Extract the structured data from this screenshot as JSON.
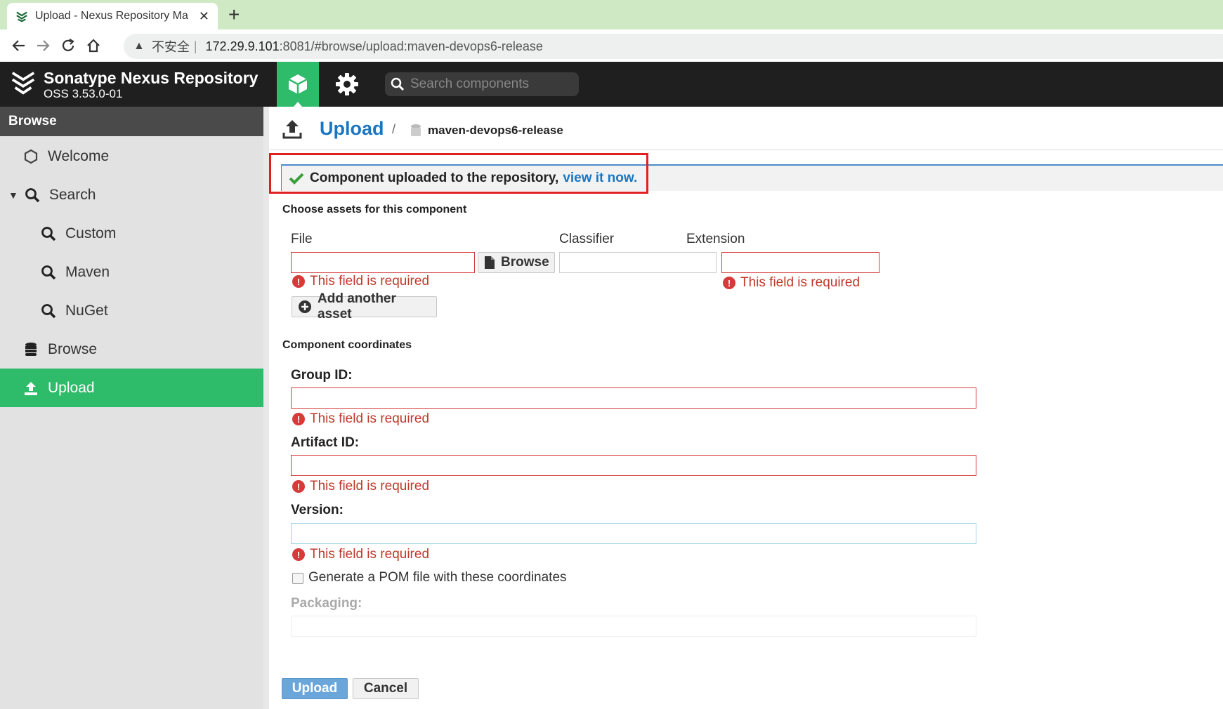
{
  "browser": {
    "tab_title": "Upload - Nexus Repository Ma",
    "new_tab": "+",
    "close": "✕",
    "address": {
      "insecure_label": "不安全",
      "separator": "|",
      "host": "172.29.9.101",
      "path": ":8081/#browse/upload:maven-devops6-release"
    }
  },
  "header": {
    "title": "Sonatype Nexus Repository",
    "version": "OSS 3.53.0-01",
    "search_placeholder": "Search components",
    "accent_color": "#2ebb6a"
  },
  "sidebar": {
    "heading": "Browse",
    "items": [
      {
        "label": "Welcome",
        "icon": "hexagon-icon"
      },
      {
        "label": "Search",
        "icon": "search-icon",
        "expanded": true
      },
      {
        "label": "Custom",
        "icon": "search-icon"
      },
      {
        "label": "Maven",
        "icon": "search-icon"
      },
      {
        "label": "NuGet",
        "icon": "search-icon"
      },
      {
        "label": "Browse",
        "icon": "database-icon"
      },
      {
        "label": "Upload",
        "icon": "upload-icon",
        "active": true
      }
    ]
  },
  "breadcrumb": {
    "title": "Upload",
    "separator": "/",
    "repository": "maven-devops6-release"
  },
  "message": {
    "text": "Component uploaded to the repository,",
    "link": "view it now."
  },
  "form": {
    "assets_heading": "Choose assets for this component",
    "file_label": "File",
    "classifier_label": "Classifier",
    "extension_label": "Extension",
    "browse_button": "Browse",
    "required_error": "This field is required",
    "add_asset_button": "Add another asset",
    "coordinates_heading": "Component coordinates",
    "group_id_label": "Group ID:",
    "artifact_id_label": "Artifact ID:",
    "version_label": "Version:",
    "generate_pom_label": "Generate a POM file with these coordinates",
    "packaging_label": "Packaging:",
    "upload_button": "Upload",
    "cancel_button": "Cancel",
    "error_color": "#c0392b"
  }
}
